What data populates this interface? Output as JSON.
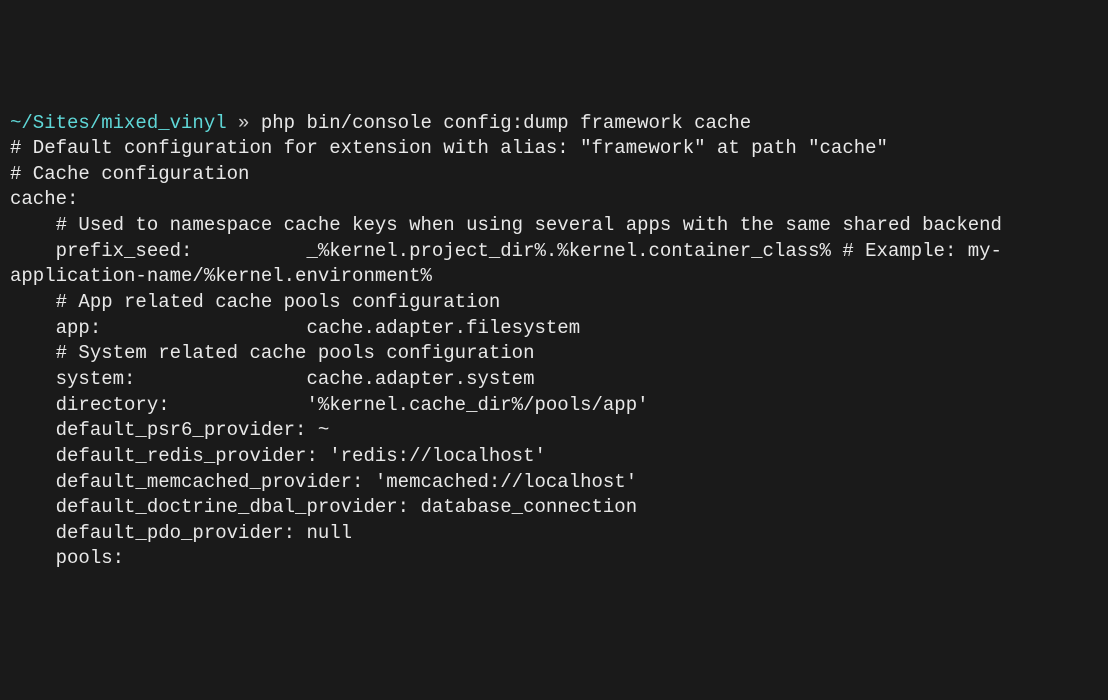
{
  "prompt": {
    "path": "~/Sites/mixed_vinyl",
    "separator": " » ",
    "command": "php bin/console config:dump framework cache"
  },
  "output": {
    "line1": "# Default configuration for extension with alias: \"framework\" at path \"cache\"",
    "line2": "",
    "line3": "# Cache configuration",
    "line4": "cache:",
    "line5": "",
    "line6": "    # Used to namespace cache keys when using several apps with the same shared backend",
    "line7": "    prefix_seed:          _%kernel.project_dir%.%kernel.container_class% # Example: my-application-name/%kernel.environment%",
    "line8": "",
    "line9": "    # App related cache pools configuration",
    "line10": "    app:                  cache.adapter.filesystem",
    "line11": "",
    "line12": "    # System related cache pools configuration",
    "line13": "    system:               cache.adapter.system",
    "line14": "    directory:            '%kernel.cache_dir%/pools/app'",
    "line15": "    default_psr6_provider: ~",
    "line16": "    default_redis_provider: 'redis://localhost'",
    "line17": "    default_memcached_provider: 'memcached://localhost'",
    "line18": "    default_doctrine_dbal_provider: database_connection",
    "line19": "    default_pdo_provider: null",
    "line20": "    pools:"
  }
}
